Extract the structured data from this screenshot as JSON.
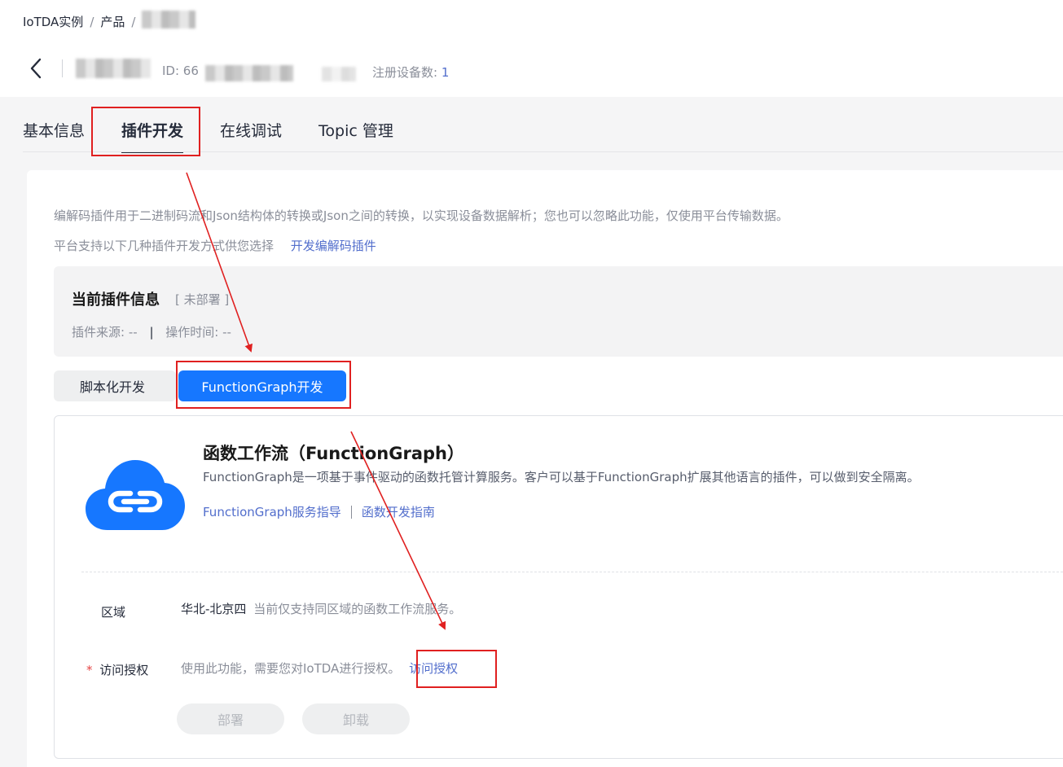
{
  "breadcrumb": {
    "instance": "IoTDA实例",
    "separator": "/",
    "product": "产品"
  },
  "header": {
    "id_label": "ID: 66",
    "registered_label": "注册设备数:",
    "registered_count": "1"
  },
  "tabs": [
    {
      "label": "基本信息",
      "active": false
    },
    {
      "label": "插件开发",
      "active": true
    },
    {
      "label": "在线调试",
      "active": false
    },
    {
      "label": "Topic 管理",
      "active": false
    }
  ],
  "intro": {
    "line1": "编解码插件用于二进制码流和Json结构体的转换或Json之间的转换，以实现设备数据解析；您也可以忽略此功能，仅使用平台传输数据。",
    "line2": "平台支持以下几种插件开发方式供您选择",
    "link": "开发编解码插件"
  },
  "plugin_info": {
    "title": "当前插件信息",
    "status": "[ 未部署 ]",
    "source_label": "插件来源: --",
    "divider": "|",
    "time_label": "操作时间: --"
  },
  "segments": {
    "script": "脚本化开发",
    "function_graph": "FunctionGraph开发"
  },
  "function_graph": {
    "title": "函数工作流（FunctionGraph）",
    "description": "FunctionGraph是一项基于事件驱动的函数托管计算服务。客户可以基于FunctionGraph扩展其他语言的插件，可以做到安全隔离。",
    "link_guide": "FunctionGraph服务指导",
    "link_dev": "函数开发指南",
    "icon": "cloud-link-icon",
    "icon_color": "#1677ff"
  },
  "form": {
    "region_label": "区域",
    "region_value": "华北-北京四",
    "region_note": "当前仅支持同区域的函数工作流服务。",
    "auth_required": "*",
    "auth_label": "访问授权",
    "auth_text": "使用此功能，需要您对IoTDA进行授权。",
    "auth_link": "访问授权"
  },
  "buttons": {
    "deploy": "部署",
    "uninstall": "卸载"
  },
  "colors": {
    "primary": "#1677ff",
    "link": "#526ecc",
    "annotation": "#e02020"
  }
}
